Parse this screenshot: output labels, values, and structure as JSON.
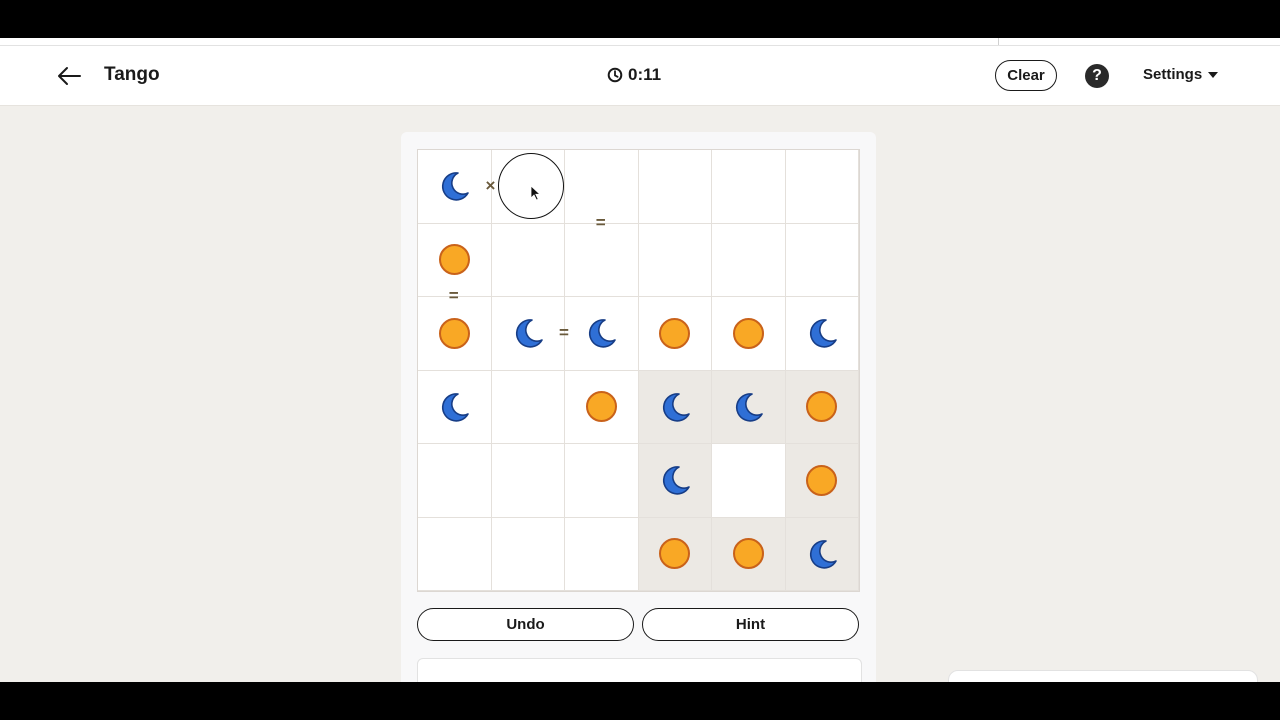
{
  "header": {
    "title": "Tango",
    "timer": "0:11",
    "clear_label": "Clear",
    "help_label": "?",
    "settings_label": "Settings"
  },
  "board": {
    "size": 6,
    "cells": [
      [
        "moon",
        "",
        "",
        "",
        "",
        ""
      ],
      [
        "sun",
        "",
        "",
        "",
        "",
        ""
      ],
      [
        "sun",
        "moon",
        "moon",
        "sun",
        "sun",
        "moon"
      ],
      [
        "moon",
        "",
        "sun",
        "moon",
        "moon",
        "sun"
      ],
      [
        "",
        "",
        "",
        "moon",
        "",
        "sun"
      ],
      [
        "",
        "",
        "",
        "sun",
        "sun",
        "moon"
      ]
    ],
    "shaded": [
      [
        false,
        false,
        false,
        false,
        false,
        false
      ],
      [
        false,
        false,
        false,
        false,
        false,
        false
      ],
      [
        false,
        false,
        false,
        false,
        false,
        false
      ],
      [
        false,
        false,
        false,
        true,
        true,
        true
      ],
      [
        false,
        false,
        false,
        true,
        false,
        true
      ],
      [
        false,
        false,
        false,
        true,
        true,
        true
      ]
    ],
    "constraints": [
      {
        "symbol": "×",
        "between": [
          [
            0,
            0
          ],
          [
            0,
            1
          ]
        ]
      },
      {
        "symbol": "=",
        "between": [
          [
            0,
            2
          ],
          [
            1,
            2
          ]
        ]
      },
      {
        "symbol": "=",
        "between": [
          [
            1,
            0
          ],
          [
            2,
            0
          ]
        ]
      },
      {
        "symbol": "=",
        "between": [
          [
            2,
            1
          ],
          [
            2,
            2
          ]
        ]
      }
    ],
    "colors": {
      "sun_fill": "#f9a825",
      "sun_stroke": "#c9621a",
      "moon_fill": "#2f6fd6",
      "moon_stroke": "#173d86",
      "shade": "#ece9e4"
    }
  },
  "controls": {
    "undo_label": "Undo",
    "hint_label": "Hint"
  },
  "icons": {
    "back": "arrow-left-icon",
    "timer": "clock-icon",
    "settings": "caret-down-icon",
    "sun": "sun-icon",
    "moon": "moon-icon"
  }
}
